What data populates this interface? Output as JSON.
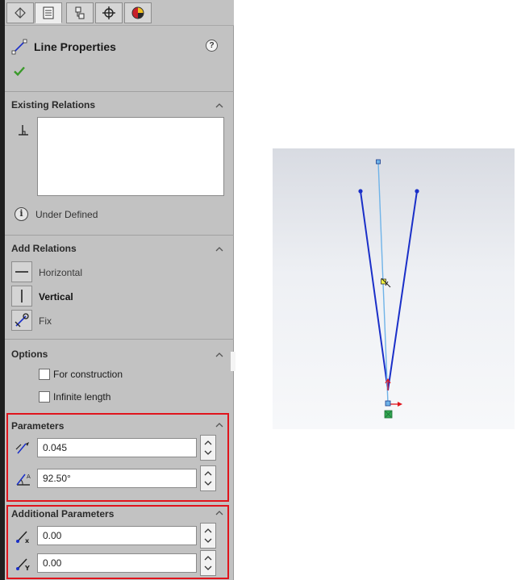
{
  "tabs": [
    {
      "icon": "feature-manager-icon"
    },
    {
      "icon": "property-manager-icon",
      "active": true
    },
    {
      "icon": "configuration-manager-icon"
    },
    {
      "icon": "dimxpert-manager-icon"
    },
    {
      "icon": "display-manager-icon"
    }
  ],
  "header": {
    "title": "Line Properties",
    "help": "?",
    "ok_icon": "checkmark-icon"
  },
  "existing_relations": {
    "title": "Existing Relations",
    "status": "Under Defined",
    "status_icon": "info-icon"
  },
  "add_relations": {
    "title": "Add Relations",
    "items": [
      {
        "label": "Horizontal",
        "bold": false,
        "icon": "horizontal-icon"
      },
      {
        "label": "Vertical",
        "bold": true,
        "icon": "vertical-icon"
      },
      {
        "label": "Fix",
        "bold": false,
        "icon": "fix-icon"
      }
    ]
  },
  "options": {
    "title": "Options",
    "for_construction": "For construction",
    "infinite_length": "Infinite length"
  },
  "parameters": {
    "title": "Parameters",
    "length": "0.045",
    "angle": "92.50°"
  },
  "additional_parameters": {
    "title": "Additional Parameters",
    "x": "0.00",
    "y": "0.00"
  },
  "colors": {
    "highlight_box": "#e0141c",
    "sketch_line": "#1a2fc8",
    "selected_line": "#6fb3e8",
    "panel_bg": "#c2c2c2"
  }
}
